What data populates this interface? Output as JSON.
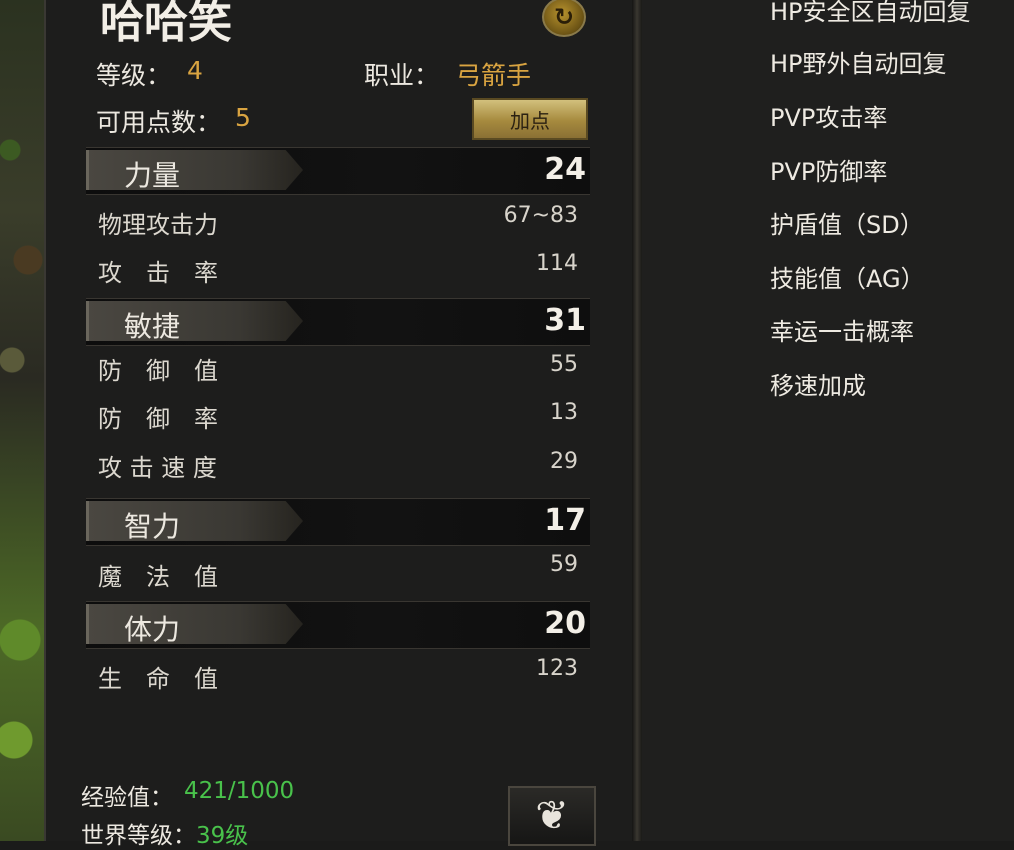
{
  "character": {
    "name": "哈哈笑",
    "level_label": "等级：",
    "level_value": "4",
    "class_label": "职业：",
    "class_value": "弓箭手",
    "points_label": "可用点数：",
    "points_value": "5",
    "add_points_label": "加点"
  },
  "attributes": [
    {
      "name": "力量",
      "value": "24",
      "stats": [
        {
          "label": "物理攻击力",
          "value": "67~83"
        },
        {
          "label": "攻　击　率",
          "value": "114"
        }
      ]
    },
    {
      "name": "敏捷",
      "value": "31",
      "stats": [
        {
          "label": "防　御　值",
          "value": "55"
        },
        {
          "label": "防　御　率",
          "value": "13"
        },
        {
          "label": "攻 击 速 度",
          "value": "29"
        }
      ]
    },
    {
      "name": "智力",
      "value": "17",
      "stats": [
        {
          "label": "魔　法　值",
          "value": "59"
        }
      ]
    },
    {
      "name": "体力",
      "value": "20",
      "stats": [
        {
          "label": "生　命　值",
          "value": "123"
        }
      ]
    }
  ],
  "footer": {
    "exp_label": "经验值：",
    "exp_value": "421/1000",
    "world_level_label": "世界等级：",
    "world_level_value": "39级"
  },
  "right_stats": [
    "HP安全区自动回复",
    "HP野外自动回复",
    "PVP攻击率",
    "PVP防御率",
    "护盾值（SD）",
    "技能值（AG）",
    "幸运一击概率",
    "移速加成"
  ],
  "colors": {
    "accent_gold": "#d9a441",
    "exp_green": "#49c24b",
    "panel_bg": "#1d1d1c"
  },
  "icons": {
    "refresh": "refresh-icon",
    "bottom": "gourd-icon"
  }
}
